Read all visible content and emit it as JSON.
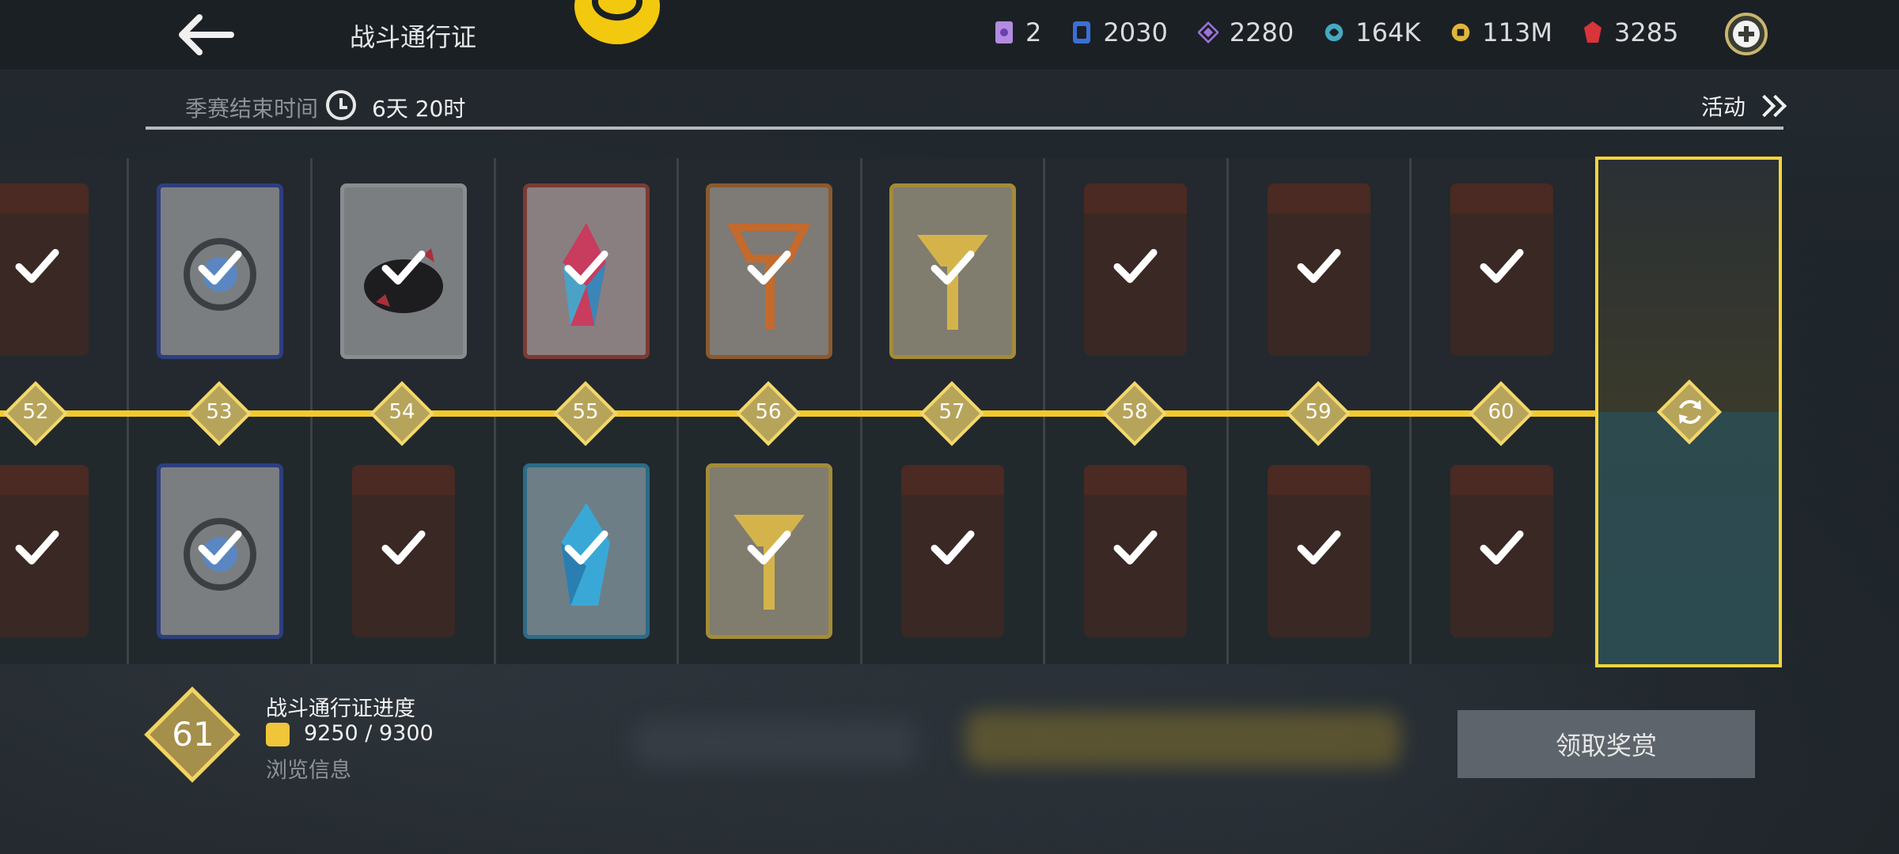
{
  "header": {
    "title": "战斗通行证",
    "currencies": [
      {
        "icon": "ticket-icon",
        "value": "2",
        "color": "#b38be0"
      },
      {
        "icon": "card-icon",
        "value": "2030",
        "color": "#3b6fd6"
      },
      {
        "icon": "purple-diamond-icon",
        "value": "2280",
        "color": "#9a72d8"
      },
      {
        "icon": "orb-icon",
        "value": "164K",
        "color": "#46a8c0"
      },
      {
        "icon": "coin-icon",
        "value": "113M",
        "color": "#e0b53a"
      },
      {
        "icon": "ruby-icon",
        "value": "3285",
        "color": "#d8343a"
      }
    ]
  },
  "season": {
    "end_label": "季赛结束时间",
    "remaining": "6天 20时",
    "activity_label": "活动"
  },
  "levels": [
    "52",
    "53",
    "54",
    "55",
    "56",
    "57",
    "58",
    "59",
    "60"
  ],
  "progress": {
    "title": "战斗通行证进度",
    "level": "61",
    "value": "9250 / 9300",
    "browse": "浏览信息"
  },
  "claim_button": "领取奖赏",
  "colors": {
    "accent": "#f3c92e",
    "track": "#23292e",
    "claim": "#5d646b"
  }
}
